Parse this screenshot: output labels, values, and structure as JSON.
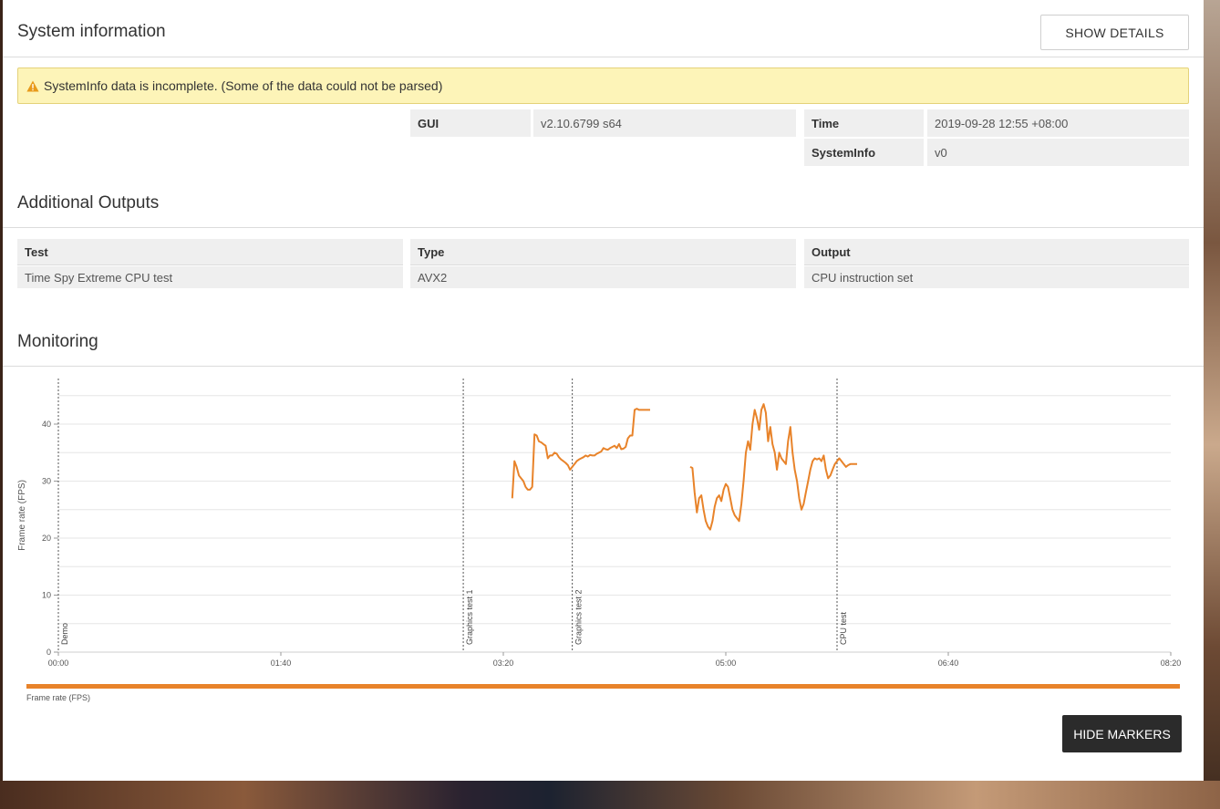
{
  "system_information": {
    "title": "System information",
    "show_details_label": "SHOW DETAILS",
    "warning_text": "SystemInfo data is incomplete. (Some of the data could not be parsed)",
    "rows": [
      {
        "key": "GUI",
        "value": "v2.10.6799 s64"
      },
      {
        "key": "Time",
        "value": "2019-09-28 12:55 +08:00"
      },
      {
        "key": "SystemInfo",
        "value": "v0"
      }
    ]
  },
  "additional_outputs": {
    "title": "Additional Outputs",
    "headers": [
      "Test",
      "Type",
      "Output"
    ],
    "rows": [
      [
        "Time Spy Extreme CPU test",
        "AVX2",
        "CPU instruction set"
      ]
    ]
  },
  "monitoring": {
    "title": "Monitoring",
    "hide_markers_label": "HIDE MARKERS",
    "legend_label": "Frame rate (FPS)",
    "series_color": "#e8832a"
  },
  "chart_data": {
    "type": "line",
    "ylabel": "Frame rate (FPS)",
    "xlabel": "",
    "ylim": [
      0,
      48
    ],
    "xlim_seconds": [
      0,
      500
    ],
    "x_ticks": [
      "00:00",
      "01:40",
      "03:20",
      "05:00",
      "06:40",
      "08:20"
    ],
    "y_ticks": [
      0,
      10,
      20,
      30,
      40
    ],
    "markers": [
      {
        "label": "Demo",
        "x": "00:00"
      },
      {
        "label": "Graphics test 1",
        "x": "03:02"
      },
      {
        "label": "Graphics test 2",
        "x": "03:51"
      },
      {
        "label": "CPU test",
        "x": "05:50"
      }
    ],
    "series": [
      {
        "name": "Frame rate (FPS)",
        "segments": [
          {
            "x": [
              "03:24",
              "03:25",
              "03:26",
              "03:27",
              "03:28",
              "03:29",
              "03:30",
              "03:31",
              "03:32",
              "03:33",
              "03:34",
              "03:35",
              "03:36",
              "03:37",
              "03:38",
              "03:39",
              "03:40",
              "03:41",
              "03:42",
              "03:43",
              "03:44",
              "03:45",
              "03:46",
              "03:47",
              "03:48",
              "03:49",
              "03:50",
              "03:51",
              "03:52",
              "03:53",
              "03:54",
              "03:55",
              "03:56",
              "03:57",
              "03:58",
              "03:59",
              "04:00",
              "04:01",
              "04:02",
              "04:03",
              "04:04",
              "04:05",
              "04:06",
              "04:07",
              "04:08",
              "04:09",
              "04:10",
              "04:11",
              "04:12",
              "04:13",
              "04:14",
              "04:15",
              "04:16",
              "04:17",
              "04:18",
              "04:19",
              "04:20",
              "04:21",
              "04:22",
              "04:23",
              "04:24",
              "04:25",
              "04:26"
            ],
            "y": [
              27,
              33.5,
              32.5,
              31,
              30.5,
              30,
              29,
              28.5,
              28.5,
              29,
              38.2,
              38,
              37,
              36.8,
              36.5,
              36.2,
              34,
              34.5,
              34.5,
              35,
              34.8,
              34.2,
              33.8,
              33.5,
              33.2,
              32.8,
              32,
              32.5,
              33,
              33.5,
              33.8,
              34,
              34.2,
              34.5,
              34.3,
              34.6,
              34.5,
              34.5,
              34.8,
              35,
              35.2,
              35.8,
              35.6,
              35.5,
              35.8,
              36,
              36.2,
              35.8,
              36.5,
              35.6,
              35.7,
              36,
              37.5,
              38,
              38,
              42.5,
              42.7,
              42.5,
              42.5,
              42.5,
              42.5,
              42.5,
              42.5
            ]
          },
          {
            "x": [
              "04:44",
              "04:45",
              "04:46",
              "04:47",
              "04:48",
              "04:49",
              "04:50",
              "04:51",
              "04:52",
              "04:53",
              "04:54",
              "04:55",
              "04:56",
              "04:57",
              "04:58",
              "04:59",
              "05:00",
              "05:01",
              "05:02",
              "05:03",
              "05:04",
              "05:05",
              "05:06",
              "05:07",
              "05:08",
              "05:09",
              "05:10",
              "05:11",
              "05:12",
              "05:13",
              "05:14",
              "05:15",
              "05:16",
              "05:17",
              "05:18",
              "05:19",
              "05:20",
              "05:21",
              "05:22",
              "05:23",
              "05:24",
              "05:25",
              "05:26",
              "05:27",
              "05:28",
              "05:29",
              "05:30",
              "05:31",
              "05:32",
              "05:33",
              "05:34",
              "05:35",
              "05:36",
              "05:37",
              "05:38",
              "05:39",
              "05:40",
              "05:41",
              "05:42",
              "05:43",
              "05:44",
              "05:45",
              "05:46",
              "05:47",
              "05:48",
              "05:49",
              "05:50",
              "05:51",
              "05:52",
              "05:53",
              "05:54",
              "05:55",
              "05:56",
              "05:57",
              "05:58",
              "05:59"
            ],
            "y": [
              32.5,
              32.3,
              28,
              24.5,
              27,
              27.5,
              25,
              23,
              22,
              21.5,
              23,
              25.5,
              27,
              27.5,
              26.5,
              28.5,
              29.5,
              29,
              27,
              25,
              24,
              23.5,
              23,
              26,
              30,
              35,
              37,
              35.5,
              40,
              42.5,
              41,
              39,
              42.5,
              43.5,
              42,
              37,
              39.5,
              36.5,
              35,
              32,
              35,
              34,
              33.5,
              33,
              37,
              39.5,
              35,
              32,
              30,
              27,
              25,
              26,
              28,
              30,
              32,
              33.5,
              34,
              33.8,
              34,
              33.5,
              34.5,
              32,
              30.5,
              31,
              32,
              33,
              33.5,
              34,
              33.5,
              33,
              32.5,
              32.8,
              33,
              33,
              33,
              33
            ]
          }
        ]
      }
    ]
  }
}
